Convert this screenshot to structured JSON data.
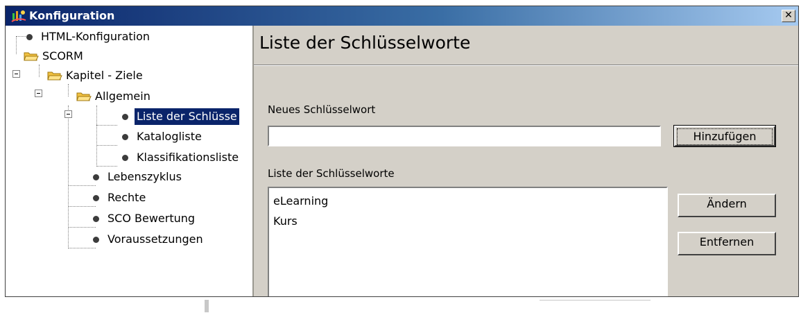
{
  "window": {
    "title": "Konfiguration",
    "close_glyph": "✕",
    "app_icon": "konfiguration-app-icon"
  },
  "tree": {
    "items": [
      {
        "label": "HTML-Konfiguration",
        "icon": "bullet"
      },
      {
        "label": "SCORM",
        "icon": "folder-open",
        "expanded": true
      },
      {
        "label": "Kapitel - Ziele",
        "icon": "folder-open",
        "expanded": true
      },
      {
        "label": "Allgemein",
        "icon": "folder-open",
        "expanded": true
      },
      {
        "label": "Liste der Schlüsse",
        "icon": "bullet",
        "selected": true
      },
      {
        "label": "Katalogliste",
        "icon": "bullet"
      },
      {
        "label": "Klassifikationsliste",
        "icon": "bullet"
      },
      {
        "label": "Lebenszyklus",
        "icon": "bullet"
      },
      {
        "label": "Rechte",
        "icon": "bullet"
      },
      {
        "label": "SCO Bewertung",
        "icon": "bullet"
      },
      {
        "label": "Voraussetzungen",
        "icon": "bullet"
      }
    ],
    "selection_color": "#0a246a"
  },
  "panel": {
    "title": "Liste der Schlüsselworte",
    "new_keyword_label": "Neues Schlüsselwort",
    "new_keyword_value": "",
    "add_button": "Hinzufügen",
    "list_label": "Liste der Schlüsselworte",
    "keywords": [
      "eLearning",
      "Kurs"
    ],
    "edit_button": "Ändern",
    "remove_button": "Entfernen"
  },
  "colors": {
    "title_gradient_start": "#0a246a",
    "title_gradient_end": "#a6caf0",
    "face": "#d4d0c8"
  }
}
